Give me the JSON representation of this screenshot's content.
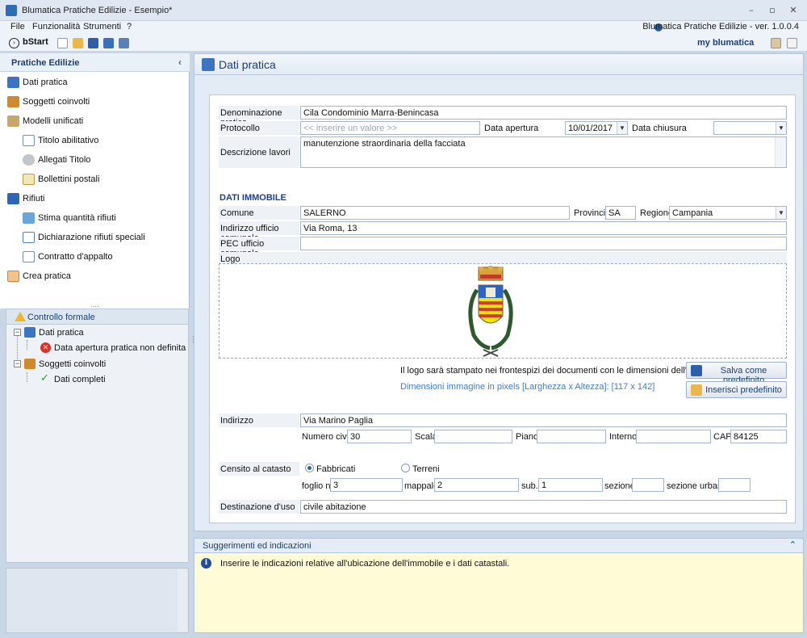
{
  "window": {
    "title": "Blumatica Pratiche Edilizie - Esempio*",
    "version": "Blumatica Pratiche Edilizie - ver. 1.0.0.4",
    "controls": [
      "–",
      "▫",
      "✕"
    ]
  },
  "menu": [
    "File",
    "Funzionalità",
    "Strumenti",
    "?"
  ],
  "toolbar": {
    "bstart": "bStart",
    "brand": "my blumatica"
  },
  "sidebar": {
    "title": "Pratiche Edilizie",
    "collapse": "‹",
    "items": [
      {
        "label": "Dati pratica",
        "icon": "house-doc-icon",
        "level": 0
      },
      {
        "label": "Soggetti coinvolti",
        "icon": "crane-icon",
        "level": 0
      },
      {
        "label": "Modelli unificati",
        "icon": "book-icon",
        "level": 0
      },
      {
        "label": "Titolo abilitativo",
        "icon": "document-icon",
        "level": 1
      },
      {
        "label": "Allegati Titolo",
        "icon": "paperclip-icon",
        "level": 1
      },
      {
        "label": "Bollettini postali",
        "icon": "postal-icon",
        "level": 1
      },
      {
        "label": "Rifiuti",
        "icon": "recycle-icon",
        "level": 0
      },
      {
        "label": "Stima quantità rifiuti",
        "icon": "chart-icon",
        "level": 1
      },
      {
        "label": "Dichiarazione rifiuti speciali",
        "icon": "declaration-icon",
        "level": 1
      },
      {
        "label": "Contratto d'appalto",
        "icon": "contract-icon",
        "level": 1
      },
      {
        "label": "Crea pratica",
        "icon": "envelope-icon",
        "level": 0
      }
    ],
    "splitter": "....",
    "controllo_formale": {
      "title": "Controllo formale",
      "nodes": [
        {
          "label": "Dati pratica",
          "children": [
            {
              "label": "Data apertura pratica non definita",
              "status": "error"
            }
          ]
        },
        {
          "label": "Soggetti coinvolti",
          "children": [
            {
              "label": "Dati completi",
              "status": "ok"
            }
          ]
        }
      ]
    }
  },
  "main": {
    "title": "Dati pratica",
    "form": {
      "denominazione": {
        "label": "Denominazione pratica",
        "value": "Cila Condominio Marra-Benincasa"
      },
      "protocollo": {
        "label": "Protocollo",
        "placeholder": "<< inserire un valore >>"
      },
      "data_apertura": {
        "label": "Data apertura",
        "value": "10/01/2017"
      },
      "data_chiusura": {
        "label": "Data chiusura",
        "value": ""
      },
      "descrizione": {
        "label": "Descrizione lavori",
        "value": "manutenzione straordinaria della facciata"
      },
      "immobile_title": "DATI IMMOBILE",
      "comune": {
        "label": "Comune",
        "value": "SALERNO"
      },
      "provincia": {
        "label": "Provincia",
        "value": "SA"
      },
      "regione": {
        "label": "Regione",
        "value": "Campania"
      },
      "indirizzo_ufficio": {
        "label": "Indirizzo ufficio comunale",
        "value": "Via Roma, 13"
      },
      "pec": {
        "label": "PEC ufficio comunale",
        "value": ""
      },
      "logo": {
        "label": "Logo",
        "alt": "Stemma del Comune di Salerno"
      },
      "logo_note": "Il logo sarà stampato nei frontespizi dei documenti con le dimensioni dell'immagine caricata.",
      "logo_dims": "Dimensioni immagine in pixels [Larghezza x Altezza]: [117 x 142]",
      "btn_salva": "Salva come predefinito",
      "btn_inserisci": "Inserisci predefinito",
      "indirizzo": {
        "label": "Indirizzo",
        "value": "Via Marino Paglia"
      },
      "numero_civico": {
        "label": "Numero civico",
        "value": "30"
      },
      "scala": {
        "label": "Scala",
        "value": ""
      },
      "piano": {
        "label": "Piano",
        "value": ""
      },
      "interno": {
        "label": "Interno",
        "value": ""
      },
      "cap": {
        "label": "CAP",
        "value": "84125"
      },
      "censito": {
        "label": "Censito al catasto",
        "opt_fabbricati": "Fabbricati",
        "opt_terreni": "Terreni",
        "selected": "Fabbricati"
      },
      "foglio": {
        "label": "foglio n.",
        "value": "3"
      },
      "mappale": {
        "label": "mappale",
        "value": "2"
      },
      "sub": {
        "label": "sub.",
        "value": "1"
      },
      "sezione": {
        "label": "sezione",
        "value": ""
      },
      "sezione_urbana": {
        "label": "sezione urbana",
        "value": ""
      },
      "destinazione": {
        "label": "Destinazione d'uso",
        "value": "civile abitazione"
      }
    }
  },
  "suggestions": {
    "title": "Suggerimenti ed indicazioni",
    "collapse": "⌃",
    "text": "Inserire le indicazioni relative all'ubicazione dell'immobile e i dati catastali."
  },
  "colors": {
    "accent": "#1c3f6e",
    "section": "#1c3f8e",
    "panel_bg": "#e3ebf4",
    "hint_bg": "#fffbd6"
  }
}
